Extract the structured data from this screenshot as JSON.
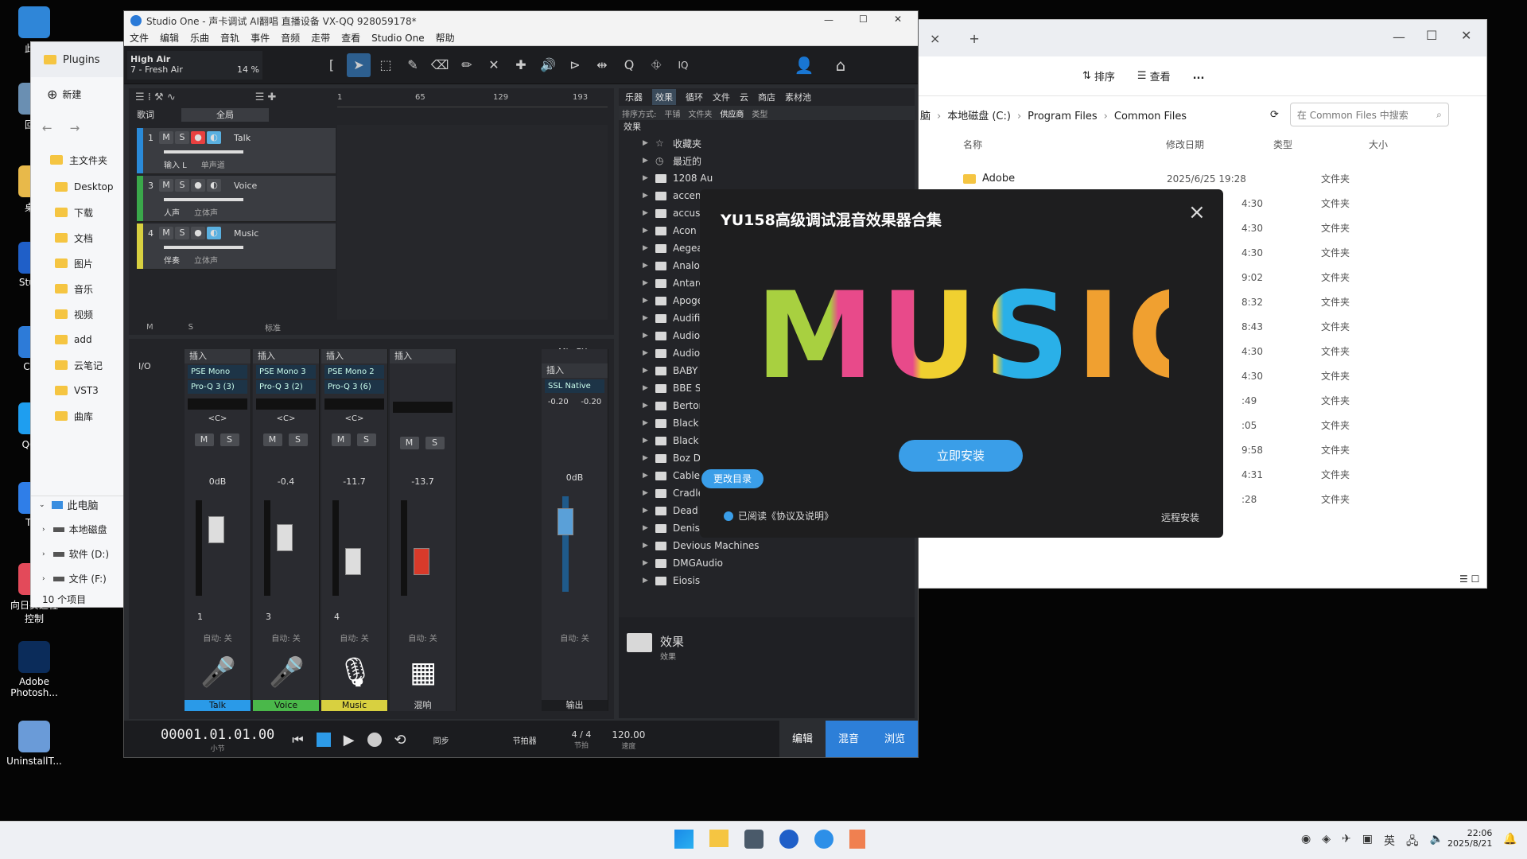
{
  "desktop": {
    "icons": [
      {
        "label": "此电",
        "color": "#2f86d8"
      },
      {
        "label": "回收",
        "color": "#6a8fb2"
      },
      {
        "label": "桌面",
        "color": "#e8b94a"
      },
      {
        "label": "Studio",
        "color": "#1f5fc8"
      },
      {
        "label": "Com",
        "color": "#2d7bd8"
      },
      {
        "label": "QQ浏",
        "color": "#1e9ef0"
      },
      {
        "label": "ToD",
        "color": "#2f7ee8"
      },
      {
        "label": "向日葵远程控制",
        "color": "#e34a5a"
      },
      {
        "label": "Adobe Photosh...",
        "color": "#0b2c5a"
      },
      {
        "label": "UninstallT...",
        "color": "#6a9bd8"
      }
    ]
  },
  "explorer_left": {
    "tab": "Plugins",
    "new_label": "新建",
    "nav": [
      "主文件夹",
      "Desktop",
      "下载",
      "文档",
      "图片",
      "音乐",
      "视频",
      "add",
      "云笔记",
      "VST3",
      "曲库"
    ],
    "tree_root": "此电脑",
    "drives": [
      "本地磁盘",
      "软件 (D:)",
      "文件 (F:)"
    ],
    "status": "10 个项目"
  },
  "explorer_right": {
    "tab_close": "×",
    "tab_add": "+",
    "toolbar": [
      "排序",
      "查看"
    ],
    "more": "...",
    "breadcrumb": [
      "脑",
      "本地磁盘 (C:)",
      "Program Files",
      "Common Files"
    ],
    "search_placeholder": "在 Common Files 中搜索",
    "columns": [
      "名称",
      "修改日期",
      "类型",
      "大小"
    ],
    "rows": [
      {
        "name": "Adobe",
        "date": "2025/6/25 19:28",
        "type": "文件夹"
      },
      {
        "name": "",
        "date": "4:30",
        "type": "文件夹"
      },
      {
        "name": "",
        "date": "4:30",
        "type": "文件夹"
      },
      {
        "name": "",
        "date": "4:30",
        "type": "文件夹"
      },
      {
        "name": "",
        "date": "9:02",
        "type": "文件夹"
      },
      {
        "name": "",
        "date": "8:32",
        "type": "文件夹"
      },
      {
        "name": "",
        "date": "8:43",
        "type": "文件夹"
      },
      {
        "name": "",
        "date": "4:30",
        "type": "文件夹"
      },
      {
        "name": "",
        "date": "4:30",
        "type": "文件夹"
      },
      {
        "name": "",
        "date": ":49",
        "type": "文件夹"
      },
      {
        "name": "",
        "date": ":05",
        "type": "文件夹"
      },
      {
        "name": "",
        "date": "9:58",
        "type": "文件夹"
      },
      {
        "name": "",
        "date": "4:31",
        "type": "文件夹"
      },
      {
        "name": "",
        "date": ":28",
        "type": "文件夹"
      }
    ]
  },
  "studio": {
    "title": "Studio One - 声卡调试 AI翻唱 直播设备 VX-QQ 928059178*",
    "menu": [
      "文件",
      "编辑",
      "乐曲",
      "音轨",
      "事件",
      "音频",
      "走带",
      "查看",
      "Studio One",
      "帮助"
    ],
    "preset": "High Air",
    "preset_sub": "7 - Fresh Air",
    "cpu": "14 %",
    "iq": "IQ",
    "ruler": [
      "1",
      "65",
      "129",
      "193"
    ],
    "lyrics": "歌词",
    "scope": "全局",
    "tracks": [
      {
        "num": "1",
        "name": "Talk",
        "input": "输入 L",
        "mode": "单声道",
        "color": "#2a8ad8"
      },
      {
        "num": "3",
        "name": "Voice",
        "input": "人声",
        "mode": "立体声",
        "color": "#3aa84a"
      },
      {
        "num": "4",
        "name": "Music",
        "input": "伴奏",
        "mode": "立体声",
        "color": "#d8d040"
      }
    ],
    "footer": {
      "m": "M",
      "s": "S",
      "norm": "标准"
    },
    "mixer": {
      "io": "I/O",
      "insert": "插入",
      "mixfx": "Mix FX",
      "channels": [
        {
          "slots": [
            "PSE Mono",
            "Pro-Q 3 (3)"
          ],
          "pan": "<C>",
          "db": "0dB",
          "num": "1",
          "auto": "自动: 关",
          "label": "Talk",
          "color": "#2a9ae8"
        },
        {
          "slots": [
            "PSE Mono 3",
            "Pro-Q 3 (2)"
          ],
          "pan": "<C>",
          "db": "-0.4",
          "num": "3",
          "auto": "自动: 关",
          "label": "Voice",
          "color": "#4ab84a"
        },
        {
          "slots": [
            "PSE Mono 2",
            "Pro-Q 3 (6)"
          ],
          "pan": "<C>",
          "db": "-11.7",
          "num": "4",
          "auto": "自动: 关",
          "label": "Music",
          "color": "#d8d040"
        },
        {
          "slots": [],
          "pan": "",
          "db": "-13.7",
          "num": "",
          "auto": "自动: 关",
          "label": "混响",
          "color": "#2a2b30"
        }
      ],
      "out": {
        "slot": "SSL Native",
        "l": "-0.20",
        "r": "-0.20",
        "db": "0dB",
        "auto": "自动: 关",
        "label": "输出"
      }
    },
    "browser": {
      "tabs": [
        "乐器",
        "效果",
        "循环",
        "文件",
        "云",
        "商店",
        "素材池"
      ],
      "sort_label": "排序方式:",
      "sorts": [
        "平铺",
        "文件夹",
        "供应商",
        "类型"
      ],
      "path": "效果",
      "items": [
        "收藏夹",
        "最近的",
        "1208 Au",
        "accentiz",
        "accuson",
        "Acon Di",
        "Aegean",
        "AnalogC",
        "Antares",
        "Apogee",
        "Audified",
        "Audiobl",
        "AudioTh",
        "BABY A",
        "BBE Sou",
        "Bertom",
        "Black Ro",
        "Black Sa",
        "Boz Digi",
        "Cablegu",
        "Cradle",
        "Dead Du",
        "Denise Audio",
        "Devious Machines",
        "DMGAudio",
        "Eiosis"
      ],
      "bottom_title": "效果",
      "bottom_sub": "效果"
    },
    "transport": {
      "time": "00001.01.01.00",
      "time_unit": "小节",
      "sync": "同步",
      "metronome": "节拍器",
      "sig": "4 / 4",
      "sig_label": "节拍",
      "tempo": "120.00",
      "tempo_label": "速度",
      "tabs": [
        "编辑",
        "混音",
        "浏览"
      ]
    }
  },
  "dialog": {
    "title": "YU158高级调试混音效果器合集",
    "art": "MUSIC",
    "install": "立即安装",
    "change_dir": "更改目录",
    "agree": "已阅读《协议及说明》",
    "remote": "远程安装",
    "close": "×"
  },
  "taskbar": {
    "time": "22:06",
    "date": "2025/8/21",
    "lang": "英"
  },
  "colors": {
    "accent": "#2d8fd8",
    "install": "#3a9ee8"
  }
}
